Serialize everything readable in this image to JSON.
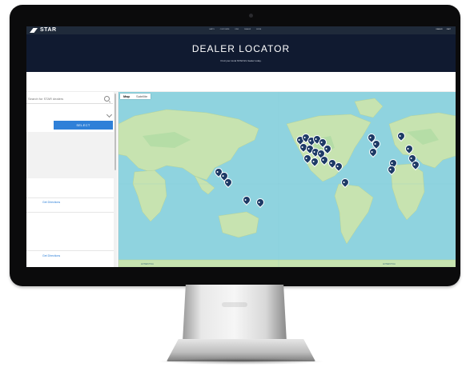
{
  "header": {
    "logo_text": "STAR",
    "nav_items": [
      "CARTS",
      "CUSTOMIZE",
      "FIND",
      "DEALER",
      "MORE"
    ],
    "util_items": [
      "DEALER",
      "CART"
    ],
    "title": "DEALER LOCATOR",
    "subtitle": "Find your local STAR EV dealer today."
  },
  "sidebar": {
    "search_placeholder": "Search for STAR dealers",
    "select_label": "SELECT",
    "directions_1": "Get Directions",
    "directions_2": "Get Directions"
  },
  "map": {
    "tabs": [
      "Map",
      "Satellite"
    ],
    "caption_left": "ANTARCTICA",
    "caption_right": "ANTARCTICA",
    "pin_count": 30,
    "colors": {
      "ocean": "#8fd3df",
      "land": "#c7e3b0",
      "pin": "#1d3a66"
    }
  }
}
